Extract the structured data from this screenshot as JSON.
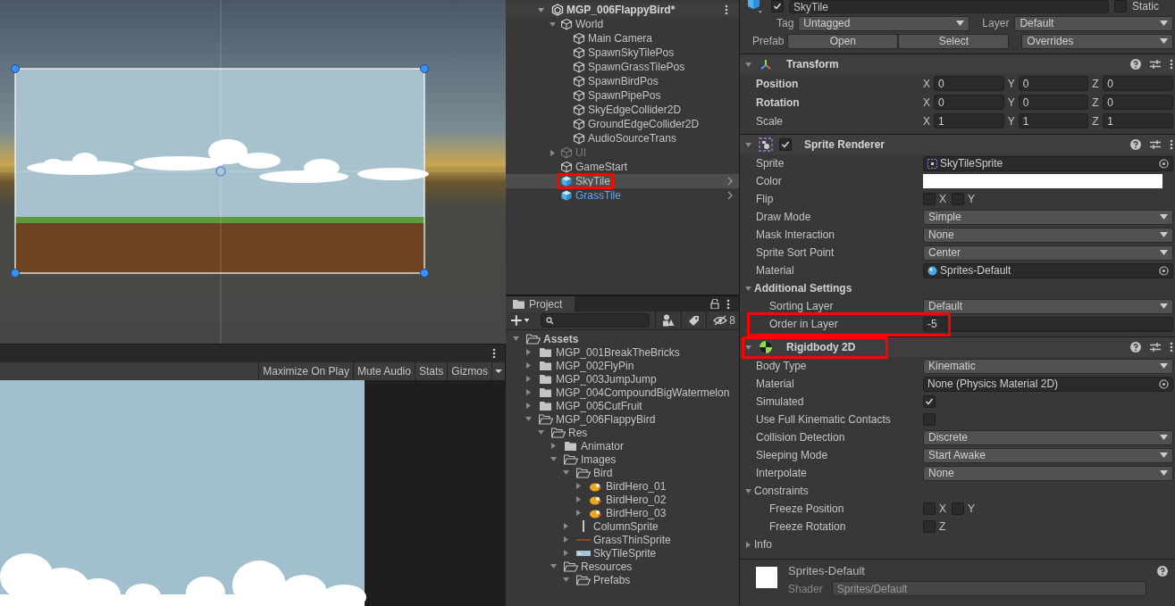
{
  "game_view": {
    "toolbar_buttons": [
      "Maximize On Play",
      "Mute Audio",
      "Stats",
      "Gizmos"
    ]
  },
  "hierarchy": {
    "scene": {
      "name": "MGP_006FlappyBird*",
      "expanded": true
    },
    "items": [
      {
        "name": "World",
        "kind": "object",
        "expanded": true,
        "selected": false,
        "children": [
          {
            "name": "Main Camera",
            "kind": "object",
            "selected": false
          },
          {
            "name": "SpawnSkyTilePos",
            "kind": "object",
            "selected": false
          },
          {
            "name": "SpawnGrassTilePos",
            "kind": "object",
            "selected": false
          },
          {
            "name": "SpawnBirdPos",
            "kind": "object",
            "selected": false
          },
          {
            "name": "SpawnPipePos",
            "kind": "object",
            "selected": false
          },
          {
            "name": "SkyEdgeCollider2D",
            "kind": "object",
            "selected": false
          },
          {
            "name": "GroundEdgeCollider2D",
            "kind": "object",
            "selected": false
          },
          {
            "name": "AudioSourceTrans",
            "kind": "object",
            "selected": false
          }
        ]
      },
      {
        "name": "UI",
        "kind": "object",
        "expanded": false,
        "active": false,
        "selected": false
      },
      {
        "name": "GameStart",
        "kind": "object",
        "selected": false
      },
      {
        "name": "SkyTile",
        "kind": "prefab",
        "selected": true,
        "highlighted": true
      },
      {
        "name": "GrassTile",
        "kind": "prefab",
        "selected": false
      }
    ]
  },
  "project": {
    "tab": "Project",
    "hidden_count": "8",
    "tree": [
      {
        "name": "Assets",
        "kind": "folder",
        "expanded": true,
        "children": [
          {
            "name": "MGP_001BreakTheBricks",
            "kind": "folder",
            "expanded": false
          },
          {
            "name": "MGP_002FlyPin",
            "kind": "folder",
            "expanded": false
          },
          {
            "name": "MGP_003JumpJump",
            "kind": "folder",
            "expanded": false
          },
          {
            "name": "MGP_004CompoundBigWatermelon",
            "kind": "folder",
            "expanded": false
          },
          {
            "name": "MGP_005CutFruit",
            "kind": "folder",
            "expanded": false
          },
          {
            "name": "MGP_006FlappyBird",
            "kind": "folder",
            "expanded": true,
            "children": [
              {
                "name": "Res",
                "kind": "folder",
                "expanded": true,
                "children": [
                  {
                    "name": "Animator",
                    "kind": "folder",
                    "expanded": false
                  },
                  {
                    "name": "Images",
                    "kind": "folder",
                    "expanded": true,
                    "children": [
                      {
                        "name": "Bird",
                        "kind": "folder",
                        "expanded": true,
                        "children": [
                          {
                            "name": "BirdHero_01",
                            "kind": "bird",
                            "expanded": false
                          },
                          {
                            "name": "BirdHero_02",
                            "kind": "bird",
                            "expanded": false
                          },
                          {
                            "name": "BirdHero_03",
                            "kind": "bird",
                            "expanded": false
                          }
                        ]
                      },
                      {
                        "name": "ColumnSprite",
                        "kind": "column",
                        "expanded": false
                      },
                      {
                        "name": "GrassThinSprite",
                        "kind": "grass",
                        "expanded": false
                      },
                      {
                        "name": "SkyTileSprite",
                        "kind": "sky",
                        "expanded": false
                      }
                    ]
                  },
                  {
                    "name": "Resources",
                    "kind": "folder",
                    "expanded": true,
                    "children": [
                      {
                        "name": "Prefabs",
                        "kind": "folder",
                        "expanded": true
                      }
                    ]
                  }
                ]
              }
            ]
          }
        ]
      }
    ]
  },
  "inspector": {
    "object": {
      "name": "SkyTile",
      "active": true,
      "static_label": "Static",
      "static": false,
      "tag_label": "Tag",
      "tag": "Untagged",
      "layer_label": "Layer",
      "layer": "Default",
      "prefab_label": "Prefab",
      "prefab_buttons": [
        "Open",
        "Select"
      ],
      "overrides": "Overrides"
    },
    "components": [
      {
        "name": "Transform",
        "kind": "transform",
        "expanded": true,
        "rows": [
          {
            "label": "Position",
            "kind": "vector",
            "bold": true,
            "axes": [
              {
                "axis": "X",
                "value": "0"
              },
              {
                "axis": "Y",
                "value": "0"
              },
              {
                "axis": "Z",
                "value": "0"
              }
            ]
          },
          {
            "label": "Rotation",
            "kind": "vector",
            "bold": true,
            "axes": [
              {
                "axis": "X",
                "value": "0"
              },
              {
                "axis": "Y",
                "value": "0"
              },
              {
                "axis": "Z",
                "value": "0"
              }
            ]
          },
          {
            "label": "Scale",
            "kind": "vector",
            "bold": false,
            "axes": [
              {
                "axis": "X",
                "value": "1"
              },
              {
                "axis": "Y",
                "value": "1"
              },
              {
                "axis": "Z",
                "value": "1"
              }
            ]
          }
        ]
      },
      {
        "name": "Sprite Renderer",
        "kind": "sprite-renderer",
        "expanded": true,
        "enabled": true,
        "rows": [
          {
            "label": "Sprite",
            "kind": "sprite-object",
            "value": "SkyTileSprite"
          },
          {
            "label": "Color",
            "kind": "color",
            "color": "#ffffff"
          },
          {
            "label": "Flip",
            "kind": "toggles",
            "toggles": [
              {
                "axis": "X",
                "checked": false
              },
              {
                "axis": "Y",
                "checked": false
              }
            ]
          },
          {
            "label": "Draw Mode",
            "kind": "dropdown",
            "value": "Simple"
          },
          {
            "label": "Mask Interaction",
            "kind": "dropdown",
            "value": "None"
          },
          {
            "label": "Sprite Sort Point",
            "kind": "dropdown",
            "value": "Center"
          },
          {
            "label": "Material",
            "kind": "material-object",
            "value": "Sprites-Default"
          },
          {
            "label": "Additional Settings",
            "kind": "foldout",
            "bold": true,
            "expanded": true,
            "children": [
              {
                "label": "Sorting Layer",
                "kind": "dropdown",
                "value": "Default"
              },
              {
                "label": "Order in Layer",
                "kind": "int",
                "value": "-5",
                "highlighted": true
              }
            ]
          }
        ]
      },
      {
        "name": "Rigidbody 2D",
        "kind": "rigidbody2d",
        "expanded": true,
        "highlighted": true,
        "rows": [
          {
            "label": "Body Type",
            "kind": "dropdown",
            "value": "Kinematic"
          },
          {
            "label": "Material",
            "kind": "object",
            "value": "None (Physics Material 2D)"
          },
          {
            "label": "Simulated",
            "kind": "checkbox",
            "checked": true
          },
          {
            "label": "Use Full Kinematic Contacts",
            "kind": "checkbox",
            "checked": false
          },
          {
            "label": "Collision Detection",
            "kind": "dropdown",
            "value": "Discrete"
          },
          {
            "label": "Sleeping Mode",
            "kind": "dropdown",
            "value": "Start Awake"
          },
          {
            "label": "Interpolate",
            "kind": "dropdown",
            "value": "None"
          },
          {
            "label": "Constraints",
            "kind": "foldout",
            "bold": false,
            "expanded": true,
            "children": [
              {
                "label": "Freeze Position",
                "kind": "toggles",
                "toggles": [
                  {
                    "axis": "X",
                    "checked": false
                  },
                  {
                    "axis": "Y",
                    "checked": false
                  }
                ]
              },
              {
                "label": "Freeze Rotation",
                "kind": "toggles",
                "toggles": [
                  {
                    "axis": "Z",
                    "checked": false
                  }
                ]
              }
            ]
          },
          {
            "label": "Info",
            "kind": "foldout",
            "bold": false,
            "expanded": false
          }
        ]
      }
    ],
    "material": {
      "name": "Sprites-Default",
      "shader_label": "Shader",
      "shader": "Sprites/Default"
    }
  }
}
